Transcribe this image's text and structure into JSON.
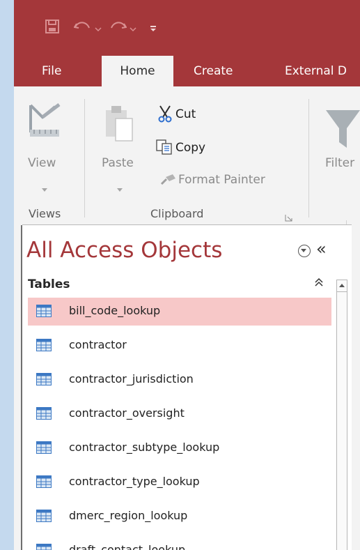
{
  "tabs": [
    {
      "label": "File",
      "active": false
    },
    {
      "label": "Home",
      "active": true
    },
    {
      "label": "Create",
      "active": false
    },
    {
      "label": "External D",
      "active": false
    }
  ],
  "ribbon": {
    "view": {
      "label": "View"
    },
    "paste": {
      "label": "Paste"
    },
    "cut": {
      "label": "Cut"
    },
    "copy": {
      "label": "Copy"
    },
    "format_painter": {
      "label": "Format Painter"
    },
    "filter": {
      "label": "Filter"
    },
    "groups": {
      "views": "Views",
      "clipboard": "Clipboard"
    }
  },
  "nav": {
    "title": "All Access Objects",
    "collapse_glyph": "«",
    "section": {
      "label": "Tables",
      "toggle_glyph": "⌃"
    },
    "items": [
      {
        "label": "bill_code_lookup",
        "selected": true
      },
      {
        "label": "contractor",
        "selected": false
      },
      {
        "label": "contractor_jurisdiction",
        "selected": false
      },
      {
        "label": "contractor_oversight",
        "selected": false
      },
      {
        "label": "contractor_subtype_lookup",
        "selected": false
      },
      {
        "label": "contractor_type_lookup",
        "selected": false
      },
      {
        "label": "dmerc_region_lookup",
        "selected": false
      },
      {
        "label": "draft_contact_lookup",
        "selected": false
      }
    ]
  },
  "colors": {
    "accent": "#a4373a",
    "selection": "#f7c8c8"
  }
}
